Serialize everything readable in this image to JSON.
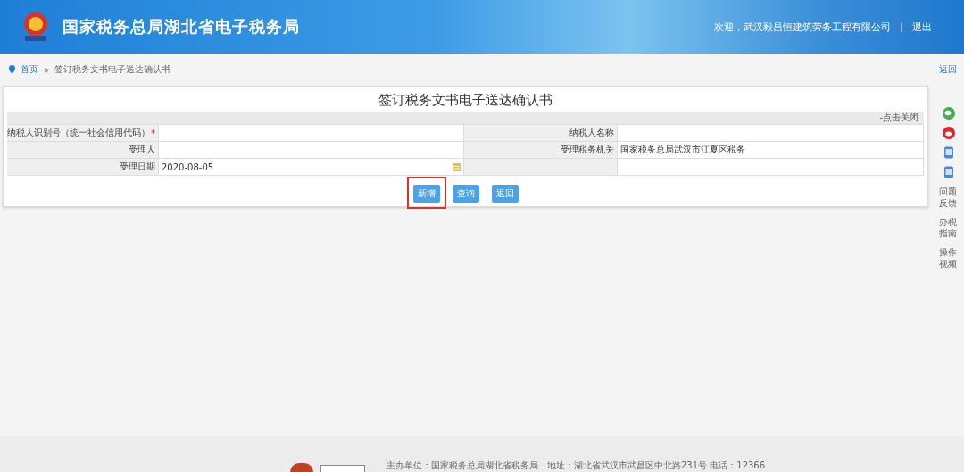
{
  "header": {
    "title": "国家税务总局湖北省电子税务局",
    "welcome": "欢迎，武汉毅昌恒建筑劳务工程有限公司",
    "separator": "|",
    "logout": "退出"
  },
  "breadcrumb": {
    "home": "首页",
    "separator": "»",
    "current": "签订税务文书电子送达确认书",
    "back": "返回"
  },
  "form": {
    "title": "签订税务文书电子送达确认书",
    "close_link": "-点击关闭",
    "rows": [
      {
        "label": "纳税人识别号（统一社会信用代码）",
        "required_mark": "*",
        "value": "",
        "label_2": "纳税人名称",
        "value_2": ""
      },
      {
        "label": "受理人",
        "value": "",
        "label_2": "受理税务机关",
        "value_2": "国家税务总局武汉市江夏区税务"
      },
      {
        "label": "受理日期",
        "value": "2020-08-05",
        "has_calendar": true,
        "label_2": "",
        "value_2": ""
      }
    ],
    "buttons": [
      {
        "label": "新增",
        "highlighted": true
      },
      {
        "label": "查询",
        "highlighted": false
      },
      {
        "label": "返回",
        "highlighted": false
      }
    ]
  },
  "side_tools": [
    {
      "kind": "wechat"
    },
    {
      "kind": "weibo"
    },
    {
      "kind": "app"
    },
    {
      "kind": "app"
    },
    {
      "kind": "text",
      "label": "问题反馈"
    },
    {
      "kind": "text",
      "label": "办税指南"
    },
    {
      "kind": "text",
      "label": "操作视频"
    }
  ],
  "footer": {
    "text": "主办单位：国家税务总局湖北省税务局　地址：湖北省武汉市武昌区中北路231号 电话：12366"
  }
}
